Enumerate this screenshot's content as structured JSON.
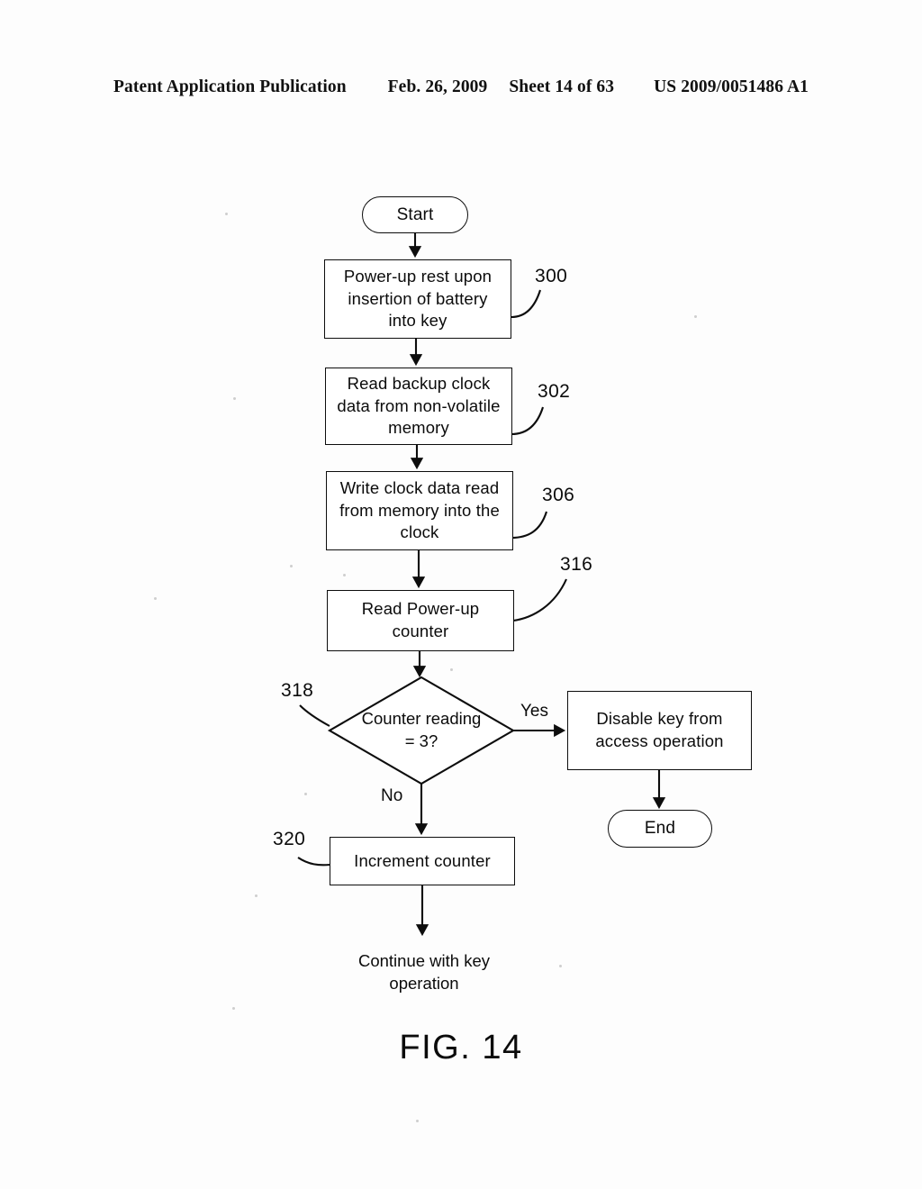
{
  "header": {
    "publication": "Patent Application Publication",
    "date": "Feb. 26, 2009",
    "sheet": "Sheet 14 of 63",
    "patent_number": "US 2009/0051486 A1"
  },
  "figure": {
    "caption": "FIG. 14",
    "nodes": {
      "start": "Start",
      "step_300": "Power-up rest upon insertion of battery into key",
      "step_302": "Read backup clock data from non-volatile memory",
      "step_306": "Write clock data read from memory into the clock",
      "step_316": "Read Power-up counter",
      "decision_318": "Counter reading = 3?",
      "disable": "Disable key from access operation",
      "end": "End",
      "step_320": "Increment counter",
      "continue": "Continue with key operation"
    },
    "reference_numerals": {
      "n300": "300",
      "n302": "302",
      "n306": "306",
      "n316": "316",
      "n318": "318",
      "n320": "320"
    },
    "branch_labels": {
      "yes": "Yes",
      "no": "No"
    }
  }
}
